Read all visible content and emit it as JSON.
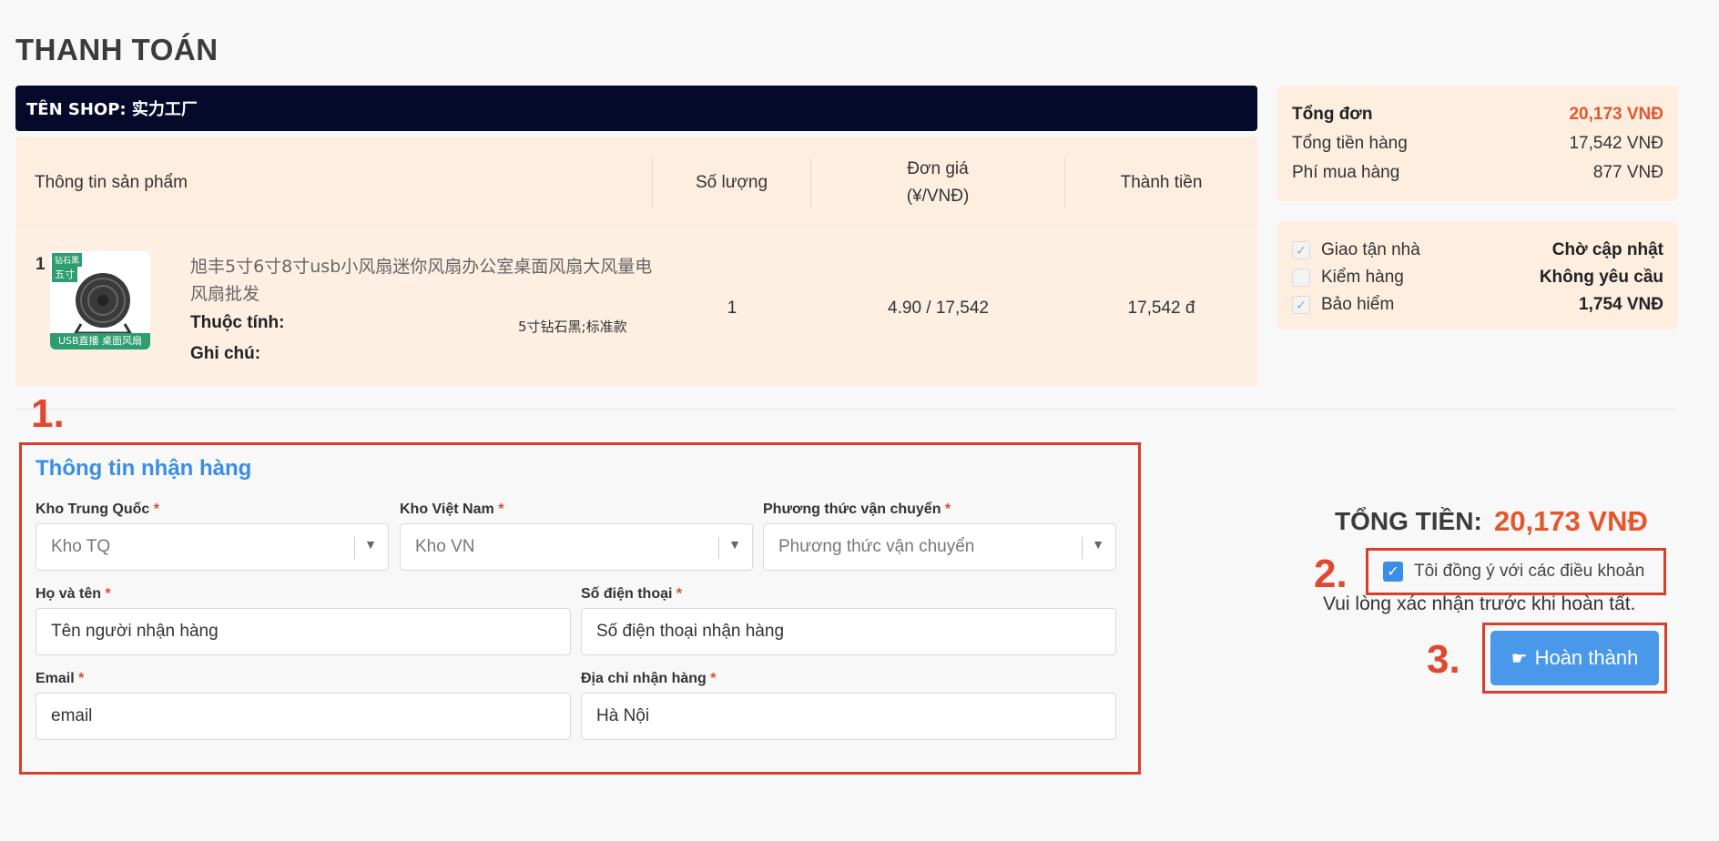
{
  "page": {
    "title": "THANH TOÁN"
  },
  "shop": {
    "label": "TÊN SHOP: 实力工厂"
  },
  "table": {
    "headers": {
      "info": "Thông tin sản phẩm",
      "qty": "Số lượng",
      "price_line1": "Đơn giá",
      "price_line2": "(¥/VNĐ)",
      "total": "Thành tiền"
    },
    "rows": [
      {
        "index": "1",
        "thumb_top": "钻石黑",
        "thumb_size": "五寸",
        "thumb_bottom": "USB直播 桌面风扇",
        "name": "旭丰5寸6寸8寸usb小风扇迷你风扇办公室桌面风扇大风量电风扇批发",
        "attr_label": "Thuộc tính:",
        "attr_value": "5寸钻石黑;标准款",
        "note_label": "Ghi chú:",
        "qty": "1",
        "price": "4.90 / 17,542",
        "total": "17,542 đ"
      }
    ]
  },
  "summary": {
    "order_total_label": "Tổng đơn",
    "order_total_value": "20,173 VNĐ",
    "goods_total_label": "Tổng tiền hàng",
    "goods_total_value": "17,542 VNĐ",
    "fee_label": "Phí mua hàng",
    "fee_value": "877 VNĐ"
  },
  "services": [
    {
      "label": "Giao tận nhà",
      "value": "Chờ cập nhật",
      "checked": true
    },
    {
      "label": "Kiểm hàng",
      "value": "Không yêu cầu",
      "checked": false
    },
    {
      "label": "Bảo hiểm",
      "value": "1,754 VNĐ",
      "checked": true
    }
  ],
  "steps": {
    "one": "1.",
    "two": "2.",
    "three": "3."
  },
  "receiver": {
    "title": "Thông tin nhận hàng",
    "required_mark": "*",
    "kho_tq": {
      "label": "Kho Trung Quốc",
      "placeholder": "Kho TQ"
    },
    "kho_vn": {
      "label": "Kho Việt Nam",
      "placeholder": "Kho VN"
    },
    "shipping": {
      "label": "Phương thức vận chuyển",
      "placeholder": "Phương thức vận chuyển"
    },
    "name": {
      "label": "Họ và tên",
      "value": "Tên người nhận hàng"
    },
    "phone": {
      "label": "Số điện thoại",
      "value": "Số điện thoại nhận hàng"
    },
    "email": {
      "label": "Email",
      "value": "email"
    },
    "address": {
      "label": "Địa chỉ nhận hàng",
      "value": "Hà Nội"
    }
  },
  "checkout": {
    "total_label": "TỔNG TIỀN:",
    "total_value": "20,173 VNĐ",
    "agree_text": "Tôi đồng ý với các điều khoản",
    "confirm_note": "Vui lòng xác nhận trước khi hoàn tất.",
    "done_label": "Hoàn thành"
  },
  "colors": {
    "accent": "#3a8ee6",
    "price": "#e4572e",
    "highlight": "#d6402a",
    "shop_bar": "#050a2b"
  }
}
